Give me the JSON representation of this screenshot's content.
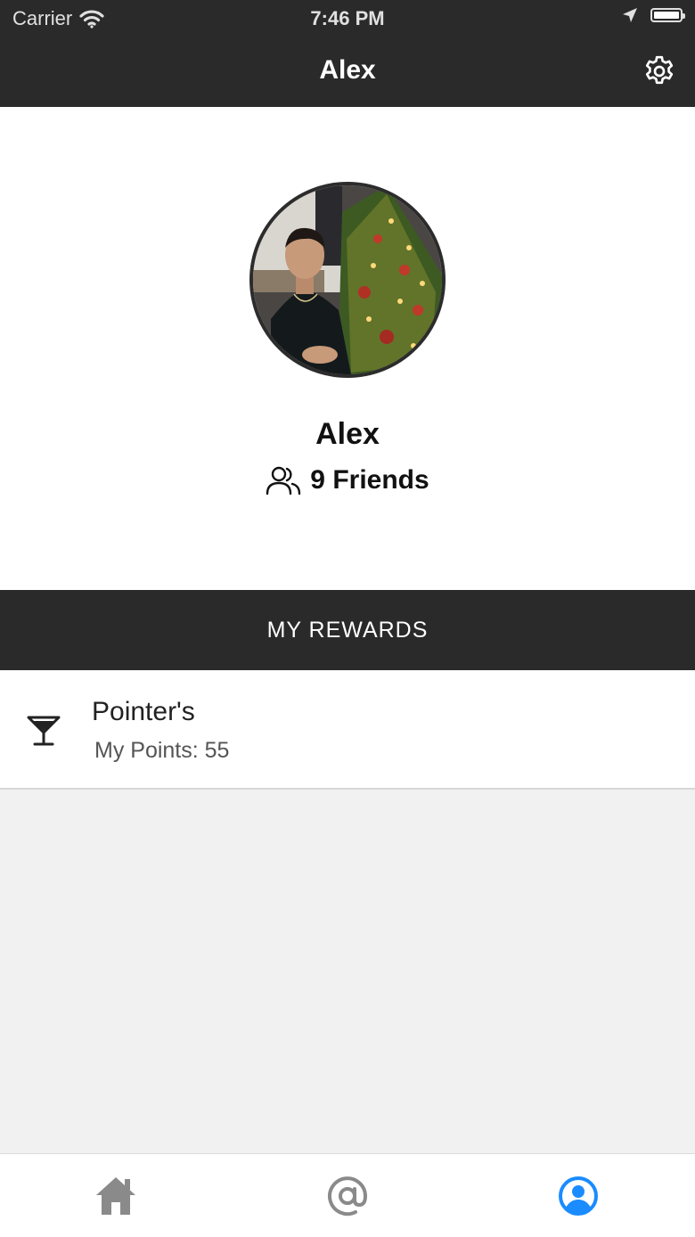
{
  "status_bar": {
    "carrier": "Carrier",
    "time": "7:46 PM",
    "battery_level": 1.0
  },
  "nav": {
    "title": "Alex",
    "settings_icon": "gear-icon"
  },
  "profile": {
    "name": "Alex",
    "friends_count": "9",
    "friends_label": "Friends"
  },
  "rewards": {
    "header": "MY REWARDS",
    "items": [
      {
        "name": "Pointer's",
        "points_label": "My Points:",
        "points": "55",
        "icon": "cocktail-icon"
      }
    ]
  },
  "tabs": [
    {
      "name": "home",
      "icon": "home-icon",
      "active": false
    },
    {
      "name": "mentions",
      "icon": "at-icon",
      "active": false
    },
    {
      "name": "profile",
      "icon": "user-circle-icon",
      "active": true
    }
  ],
  "colors": {
    "bar": "#2a2a2a",
    "accent": "#1a8cff",
    "inactive": "#8a8a8a"
  }
}
